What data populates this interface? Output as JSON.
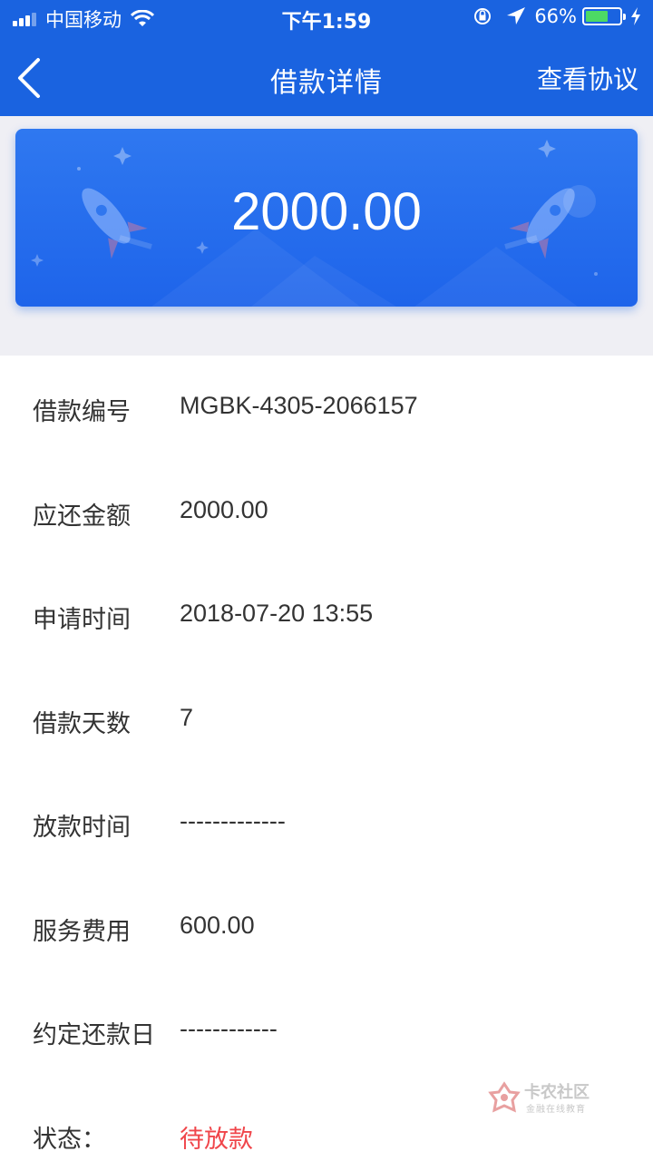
{
  "status_bar": {
    "carrier": "中国移动",
    "time": "下午1:59",
    "battery": "66%",
    "battery_level": 0.66
  },
  "nav": {
    "title": "借款详情",
    "action": "查看协议"
  },
  "amount": "2000.00",
  "details": [
    {
      "label": "借款编号",
      "value": "MGBK-4305-2066157"
    },
    {
      "label": "应还金额",
      "value": "2000.00"
    },
    {
      "label": "申请时间",
      "value": "2018-07-20 13:55"
    },
    {
      "label": "借款天数",
      "value": "7"
    },
    {
      "label": "放款时间",
      "value": "-------------"
    },
    {
      "label": "服务费用",
      "value": "600.00"
    },
    {
      "label": "约定还款日",
      "value": "------------"
    },
    {
      "label": "状态：",
      "value": "待放款"
    }
  ],
  "watermark": {
    "title": "卡农社区",
    "subtitle": "金融在线教育"
  },
  "colors": {
    "brand_blue": "#1a63e0",
    "status_red": "#f0464b"
  }
}
